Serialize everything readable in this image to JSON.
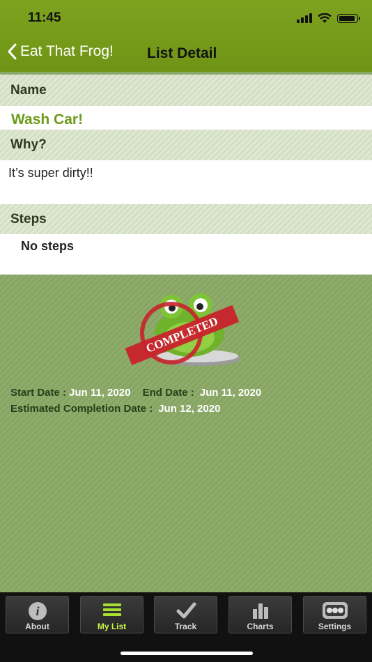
{
  "status": {
    "time": "11:45"
  },
  "nav": {
    "back_label": "Eat That Frog!",
    "title": "List Detail"
  },
  "sections": {
    "name_header": "Name",
    "name_value": "Wash Car!",
    "why_header": "Why?",
    "why_value": "It’s super dirty!!",
    "steps_header": "Steps",
    "steps_value": "No steps"
  },
  "badge": {
    "stamp_text": "COMPLETED"
  },
  "dates": {
    "start_label": "Start Date :",
    "start_value": "Jun 11, 2020",
    "end_label": "End Date :",
    "end_value": "Jun 11, 2020",
    "est_label": "Estimated Completion Date :",
    "est_value": "Jun 12, 2020"
  },
  "tabs": [
    {
      "label": "About",
      "icon": "info-icon",
      "active": false
    },
    {
      "label": "My List",
      "icon": "list-icon",
      "active": true
    },
    {
      "label": "Track",
      "icon": "checkmark-icon",
      "active": false
    },
    {
      "label": "Charts",
      "icon": "bar-chart-icon",
      "active": false
    },
    {
      "label": "Settings",
      "icon": "settings-icon",
      "active": false
    }
  ],
  "colors": {
    "header_green": "#7ea31f",
    "accent_text": "#6d9a1a",
    "active_tab": "#c9f54a"
  }
}
